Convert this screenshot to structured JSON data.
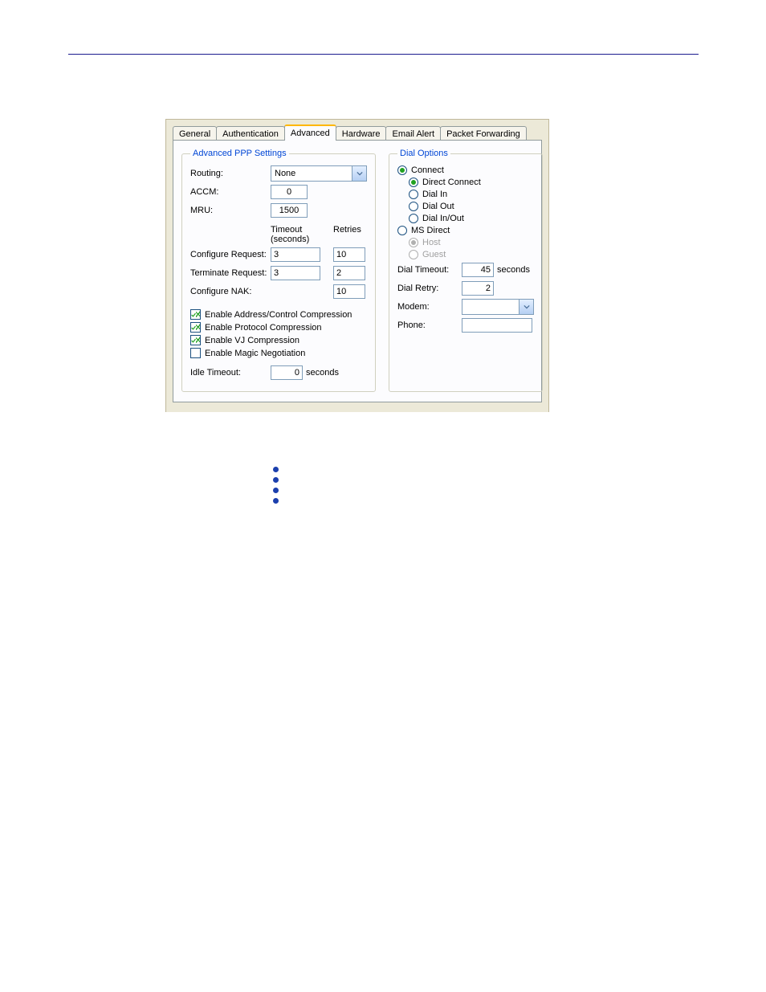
{
  "tabs": {
    "general": "General",
    "authentication": "Authentication",
    "advanced": "Advanced",
    "hardware": "Hardware",
    "email_alert": "Email Alert",
    "packet_forwarding": "Packet Forwarding"
  },
  "legend_left": "Advanced PPP Settings",
  "routing_label": "Routing:",
  "routing_value": "None",
  "accm_label": "ACCM:",
  "accm_value": "0",
  "mru_label": "MRU:",
  "mru_value": "1500",
  "col_timeout": "Timeout (seconds)",
  "col_retries": "Retries",
  "cfg_req_label": "Configure Request:",
  "cfg_req_timeout": "3",
  "cfg_req_retries": "10",
  "term_req_label": "Terminate Request:",
  "term_req_timeout": "3",
  "term_req_retries": "2",
  "cfg_nak_label": "Configure NAK:",
  "cfg_nak_retries": "10",
  "cb_addrctrl": "Enable Address/Control Compression",
  "cb_proto": "Enable Protocol Compression",
  "cb_vj": "Enable VJ Compression",
  "cb_magic": "Enable Magic Negotiation",
  "idle_label": "Idle Timeout:",
  "idle_value": "0",
  "seconds": "seconds",
  "legend_right": "Dial Options",
  "opt_connect": "Connect",
  "opt_direct_connect": "Direct Connect",
  "opt_dial_in": "Dial In",
  "opt_dial_out": "Dial Out",
  "opt_dial_inout": "Dial In/Out",
  "opt_ms_direct": "MS Direct",
  "opt_host": "Host",
  "opt_guest": "Guest",
  "dial_timeout_label": "Dial Timeout:",
  "dial_timeout_value": "45",
  "dial_retry_label": "Dial Retry:",
  "dial_retry_value": "2",
  "modem_label": "Modem:",
  "phone_label": "Phone:"
}
